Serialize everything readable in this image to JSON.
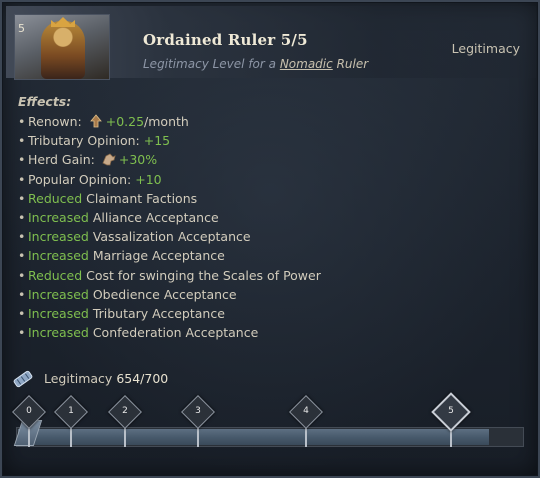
{
  "header": {
    "level_number": "5",
    "title": "Ordained Ruler 5/5",
    "subtitle_prefix": "Legitimacy Level for a",
    "subtitle_link": "Nomadic",
    "subtitle_suffix": "Ruler",
    "category": "Legitimacy"
  },
  "effects": {
    "heading": "Effects:",
    "items": [
      {
        "prefix": "Renown: ",
        "icon": "renown-icon",
        "value": "+0.25",
        "suffix": "/month"
      },
      {
        "prefix": "Tributary Opinion: ",
        "value": "+15"
      },
      {
        "prefix": "Herd Gain: ",
        "icon": "herd-icon",
        "value": "+30%"
      },
      {
        "prefix": "Popular Opinion: ",
        "value": "+10"
      },
      {
        "keyword": "Reduced",
        "rest": " Claimant Factions"
      },
      {
        "keyword": "Increased",
        "rest": " Alliance Acceptance"
      },
      {
        "keyword": "Increased",
        "rest": " Vassalization Acceptance"
      },
      {
        "keyword": "Increased",
        "rest": " Marriage Acceptance"
      },
      {
        "keyword": "Reduced",
        "rest": " Cost for swinging the Scales of Power"
      },
      {
        "keyword": "Increased",
        "rest": " Obedience Acceptance"
      },
      {
        "keyword": "Increased",
        "rest": " Tributary Acceptance"
      },
      {
        "keyword": "Increased",
        "rest": " Confederation Acceptance"
      }
    ]
  },
  "legitimacy": {
    "label": "Legitimacy",
    "value": "654/700",
    "current": 654,
    "max": 700,
    "milestones": [
      "0",
      "1",
      "2",
      "3",
      "4",
      "5"
    ],
    "milestone_values": [
      0,
      75,
      150,
      250,
      400,
      600
    ],
    "active_level": 5
  },
  "colors": {
    "positive": "#7fbf4f",
    "text": "#d2ccbc",
    "title": "#efe9d6"
  }
}
